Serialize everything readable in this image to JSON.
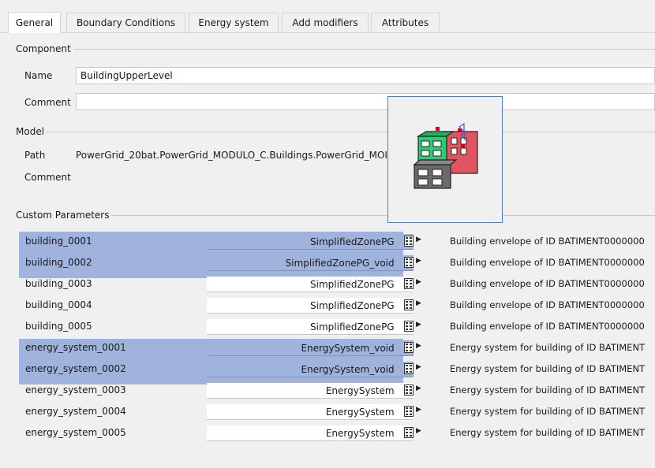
{
  "tabs": [
    {
      "label": "General",
      "active": true
    },
    {
      "label": "Boundary Conditions",
      "active": false
    },
    {
      "label": "Energy system",
      "active": false
    },
    {
      "label": "Add modifiers",
      "active": false
    },
    {
      "label": "Attributes",
      "active": false
    }
  ],
  "component": {
    "header": "Component",
    "name_label": "Name",
    "name_value": "BuildingUpperLevel",
    "comment_label": "Comment",
    "comment_value": ""
  },
  "model": {
    "header": "Model",
    "path_label": "Path",
    "path_value": "PowerGrid_20bat.PowerGrid_MODULO_C.Buildings.PowerGrid_MOI",
    "comment_label": "Comment"
  },
  "custom_parameters": {
    "header": "Custom Parameters",
    "rows": [
      {
        "name": "building_0001",
        "value": "SimplifiedZonePG",
        "description": "Building envelope of ID BATIMENT0000000",
        "selected": true
      },
      {
        "name": "building_0002",
        "value": "SimplifiedZonePG_void",
        "description": "Building envelope of ID BATIMENT0000000",
        "selected": true
      },
      {
        "name": "building_0003",
        "value": "SimplifiedZonePG",
        "description": "Building envelope of ID BATIMENT0000000",
        "selected": false
      },
      {
        "name": "building_0004",
        "value": "SimplifiedZonePG",
        "description": "Building envelope of ID BATIMENT0000000",
        "selected": false
      },
      {
        "name": "building_0005",
        "value": "SimplifiedZonePG",
        "description": "Building envelope of ID BATIMENT0000000",
        "selected": false
      },
      {
        "name": "energy_system_0001",
        "value": "EnergySystem_void",
        "description": "Energy system for building of ID BATIMENT",
        "selected": true
      },
      {
        "name": "energy_system_0002",
        "value": "EnergySystem_void",
        "description": "Energy system for building of ID BATIMENT",
        "selected": true
      },
      {
        "name": "energy_system_0003",
        "value": "EnergySystem",
        "description": "Energy system for building of ID BATIMENT",
        "selected": false
      },
      {
        "name": "energy_system_0004",
        "value": "EnergySystem",
        "description": "Energy system for building of ID BATIMENT",
        "selected": false
      },
      {
        "name": "energy_system_0005",
        "value": "EnergySystem",
        "description": "Energy system for building of ID BATIMENT",
        "selected": false
      }
    ]
  },
  "colors": {
    "selection": "#9fb3dc",
    "preview_border": "#4a7bd0",
    "icon_green": "#2ecc71",
    "icon_red": "#e05560",
    "icon_grey": "#6b6b6b"
  },
  "icons": {
    "model_preview": "building-model-icon",
    "row_button": "parameter-dialog-icon",
    "row_arrow": "triangle-right-icon",
    "dropdown": "chevron-down-icon"
  }
}
